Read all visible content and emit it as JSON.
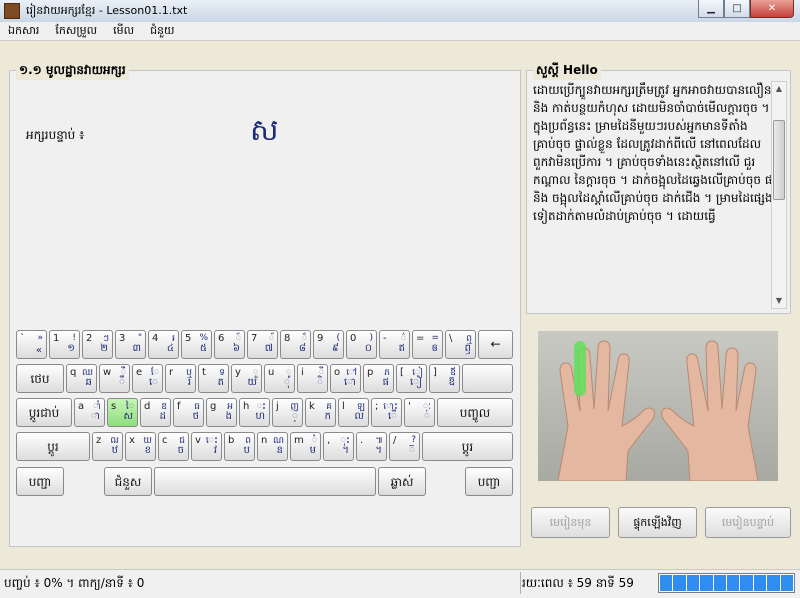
{
  "window": {
    "title": "រៀនវាយអក្សរខ្មែរ - Lesson01.1.txt",
    "icon": "app-icon"
  },
  "menu": [
    "ឯកសារ",
    "កែសម្រួល",
    "មើល",
    "ជំនួយ"
  ],
  "lesson": {
    "title": "១.១ មូលដ្ឋានវាយអក្សរ",
    "next_label": "អក្សរបន្ទាប់ ៖",
    "next_char": "ស"
  },
  "story": {
    "title": "សួស្ដី Hello",
    "text": "ដោយប្រើក្បួនវាយអក្សរត្រឹមត្រូវ អ្នកអាចវាយបានលឿន និង កាត់បន្ថយកំហុស ដោយមិនចាំបាច់មើលក្ដារចុច ។\nក្នុងប្រព័ន្ធនេះ ម្រាមដៃនីមួយៗរបស់អ្នកមានទីតាំងគ្រាប់ចុច ផ្ទាល់ខ្លួន ដែលត្រូវដាក់ពីលើ នៅពេលដែលពួកវាមិនប្រើការ ។ គ្រាប់ចុចទាំងនេះស្ថិតនៅលើ ជួរកណ្ដាល នៃក្ដារចុច ។ ដាក់ចង្អុលដៃឆ្វេងលើគ្រាប់ចុច ផ និង ចង្អុលដៃស្ដាំលើគ្រាប់ចុច ដាក់ជើង ។ ម្រាមដៃផ្សេងទៀតដាក់តាមលំដាប់គ្រាប់ចុច ។ ដោយធ្វើ"
  },
  "keyboard": {
    "row1": [
      {
        "l": "`",
        "r": "»",
        "b": "«"
      },
      {
        "l": "1",
        "r": "!",
        "b": "១"
      },
      {
        "l": "2",
        "r": "ៗ",
        "b": "២"
      },
      {
        "l": "3",
        "r": "\"",
        "b": "៣"
      },
      {
        "l": "4",
        "r": "៛",
        "b": "៤"
      },
      {
        "l": "5",
        "r": "%",
        "b": "៥"
      },
      {
        "l": "6",
        "r": "៍",
        "b": "៦"
      },
      {
        "l": "7",
        "r": "័",
        "b": "៧"
      },
      {
        "l": "8",
        "r": "៏",
        "b": "៨"
      },
      {
        "l": "9",
        "r": "(",
        "b": "៩"
      },
      {
        "l": "0",
        "r": ")",
        "b": "០"
      },
      {
        "l": "-",
        "r": "៌",
        "b": "ឥ"
      },
      {
        "l": "=",
        "r": "=",
        "b": "ឲ"
      },
      {
        "l": "\\",
        "r": "ឮ",
        "b": "ឭ"
      }
    ],
    "backspace": "←",
    "tab_label": "ថេប",
    "row2": [
      {
        "l": "q",
        "r": "ឈ",
        "b": "ឆ"
      },
      {
        "l": "w",
        "r": "ឺ",
        "b": "ឹ"
      },
      {
        "l": "e",
        "r": "ែ",
        "b": "េ"
      },
      {
        "l": "r",
        "r": "ឬ",
        "b": "រ"
      },
      {
        "l": "t",
        "r": "ទ",
        "b": "ត"
      },
      {
        "l": "y",
        "r": "ួ",
        "b": "យ"
      },
      {
        "l": "u",
        "r": "ូ",
        "b": "ុ"
      },
      {
        "l": "i",
        "r": "ី",
        "b": "ិ"
      },
      {
        "l": "o",
        "r": "ៅ",
        "b": "ោ"
      },
      {
        "l": "p",
        "r": "ភ",
        "b": "ផ"
      },
      {
        "l": "[",
        "r": "ៀ",
        "b": "ៀ"
      },
      {
        "l": "]",
        "r": "ឪ",
        "b": "ឨ"
      }
    ],
    "caps_label": "ប្ដូរជាប់",
    "row3": [
      {
        "l": "a",
        "r": "ាំ",
        "b": "ា"
      },
      {
        "l": "s",
        "r": "ៃ",
        "b": "ស"
      },
      {
        "l": "d",
        "r": "ឌ",
        "b": "ដ"
      },
      {
        "l": "f",
        "r": "ធ",
        "b": "ថ"
      },
      {
        "l": "g",
        "r": "អ",
        "b": "ង"
      },
      {
        "l": "h",
        "r": "ះ",
        "b": "ហ"
      },
      {
        "l": "j",
        "r": "ញ",
        "b": "្"
      },
      {
        "l": "k",
        "r": "គ",
        "b": "ក"
      },
      {
        "l": "l",
        "r": "ឡ",
        "b": "ល"
      },
      {
        "l": ";",
        "r": "ោះ",
        "b": "ើ"
      },
      {
        "l": "'",
        "r": "ៈ",
        "b": "់"
      }
    ],
    "enter_label": "បញ្ចូល",
    "shift_label": "ប្ដូរ",
    "row4": [
      {
        "l": "z",
        "r": "ឍ",
        "b": "ឋ"
      },
      {
        "l": "x",
        "r": "ឃ",
        "b": "ខ"
      },
      {
        "l": "c",
        "r": "ជ",
        "b": "ច"
      },
      {
        "l": "v",
        "r": "េះ",
        "b": "វ"
      },
      {
        "l": "b",
        "r": "ព",
        "b": "ប"
      },
      {
        "l": "n",
        "r": "ណ",
        "b": "ន"
      },
      {
        "l": "m",
        "r": "ំ",
        "b": "ម"
      },
      {
        "l": ",",
        "r": "ុះ",
        "b": "។"
      },
      {
        "l": ".",
        "r": "៕",
        "b": "។"
      },
      {
        "l": "/",
        "r": "?",
        "b": "៊"
      }
    ],
    "shift_right_label": "ប្ដូរ",
    "ctrl_label": "បញ្ជា",
    "alt_label": "ជំនួស",
    "altgr_label": "ឆ្លាស់",
    "ctrl_right_label": "បញ្ជា",
    "highlight_key": "s"
  },
  "buttons": {
    "prev": "មេរៀនមុន",
    "reload": "ផ្ទុកឡើងវិញ",
    "next": "មេរៀនបន្ទាប់"
  },
  "status": {
    "left": "បញ្ចប់ ៖ 0% ។ ពាក្យ/នាទី ៖ 0",
    "time": "រយៈពេល ៖ 59 នាទី 59"
  },
  "progress_percent": 100,
  "colors": {
    "accent": "#2f8df0",
    "highlight": "#9fe48b"
  }
}
